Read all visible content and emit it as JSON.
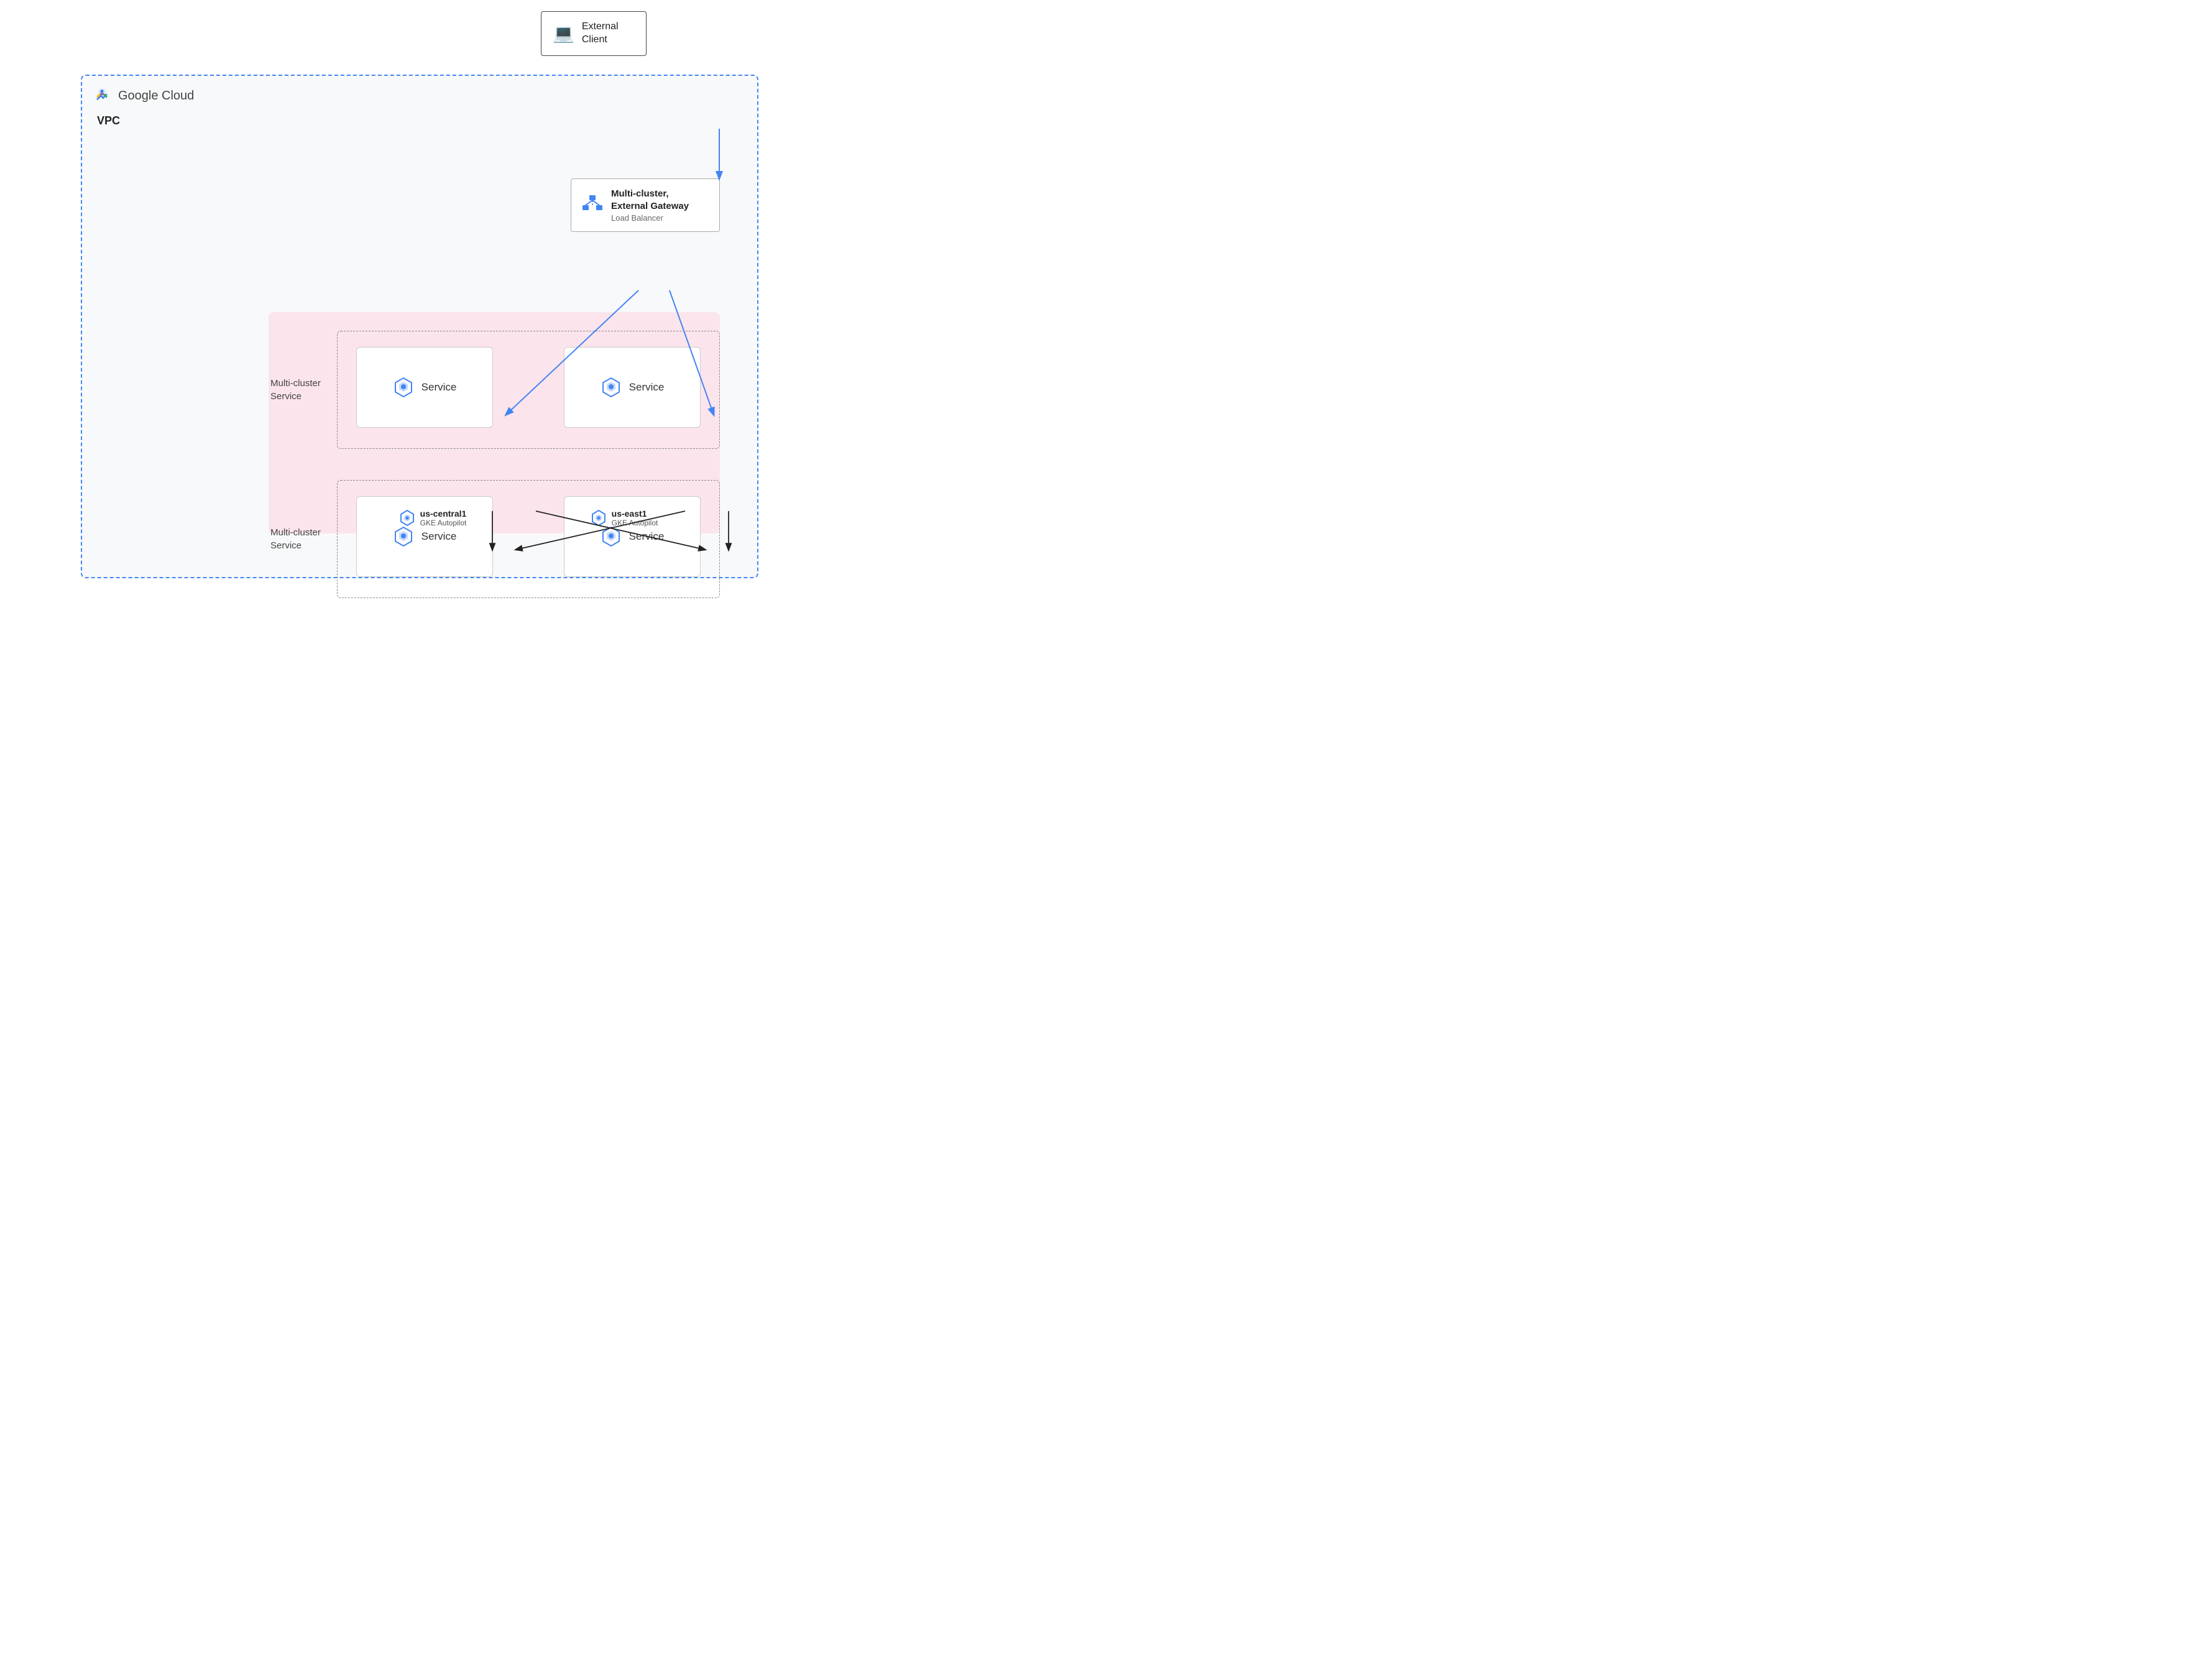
{
  "external_client": {
    "label": "External\nClient",
    "label_line1": "External",
    "label_line2": "Client"
  },
  "vpc": {
    "label": "VPC"
  },
  "google_cloud": {
    "text": "Google Cloud"
  },
  "gateway": {
    "title": "Multi-cluster,\nExternal Gateway",
    "title_line1": "Multi-cluster,",
    "title_line2": "External Gateway",
    "subtitle": "Load Balancer"
  },
  "multi_cluster_service_top": {
    "label_line1": "Multi-cluster",
    "label_line2": "Service"
  },
  "multi_cluster_service_bottom": {
    "label_line1": "Multi-cluster",
    "label_line2": "Service"
  },
  "services": {
    "top_left": "Service",
    "top_right": "Service",
    "bottom_left": "Service",
    "bottom_right": "Service"
  },
  "gke_clusters": {
    "left": {
      "region": "us-central1",
      "type": "GKE Autopilot"
    },
    "right": {
      "region": "us-east1",
      "type": "GKE Autopilot"
    }
  },
  "colors": {
    "blue": "#4285F4",
    "pink_bg": "#fce4ec",
    "dashed_border": "#4285F4",
    "arrow_blue": "#4285F4",
    "arrow_black": "#222"
  }
}
